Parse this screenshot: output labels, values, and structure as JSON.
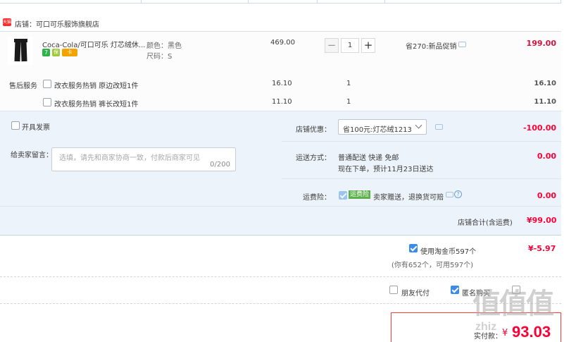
{
  "shop": {
    "icon": "tmall-store-icon",
    "label": "店铺：可口可乐服饰旗舰店"
  },
  "item": {
    "image": "black-pants-thumbnail",
    "title": "Coca-Cola/可口可乐 灯芯绒休...",
    "color": "颜色：黑色",
    "size": "尺码：S",
    "badges": [
      "7",
      "保",
      "卡"
    ],
    "unit_price": "469.00",
    "quantity": "1",
    "minus": "−",
    "plus": "+",
    "promo": "省270:新品促销",
    "subtotal": "199.00"
  },
  "after_sales": {
    "title": "售后服务",
    "services": [
      {
        "name": "改衣服务热销 原边改短1件",
        "price": "16.10",
        "qty": "1",
        "total": "16.10"
      },
      {
        "name": "改衣服务热销 裤长改短1件",
        "price": "11.10",
        "qty": "1",
        "total": "11.10"
      }
    ]
  },
  "invoice": {
    "label": "开具发票"
  },
  "message": {
    "label": "给卖家留言：",
    "placeholder": "选填，请先和商家协商一致，付款后商家可见",
    "counter": "0/200"
  },
  "discount": {
    "label": "店铺优惠：",
    "selected": "省100元:灯芯绒1213",
    "amount": "-100.00"
  },
  "shipping": {
    "label": "运送方式：",
    "method": "普通配送 快递 免邮",
    "eta": "现在下单，预计11月23日送达",
    "amount": "0.00"
  },
  "insurance": {
    "label": "运费险：",
    "badge": "运费险",
    "desc": "卖家赠送，退换货可赔",
    "amount": "0.00"
  },
  "shop_total": {
    "label": "店铺合计(含运费)",
    "amount": "¥99.00"
  },
  "coins": {
    "label": "使用淘金币597个",
    "sub": "(你有652个，可用597个)",
    "amount": "¥-5.97"
  },
  "options": {
    "friend_pay": "朋友代付",
    "anonymous": "匿名购买"
  },
  "payment": {
    "label": "实付款：",
    "currency": "¥",
    "amount": "93.03"
  },
  "watermark": {
    "logo": "值值值",
    "site": "zhiz"
  },
  "colors": {
    "price_red": "#d1143e",
    "accent_blue": "#3d8be8",
    "band_bg": "#edf3fa"
  }
}
